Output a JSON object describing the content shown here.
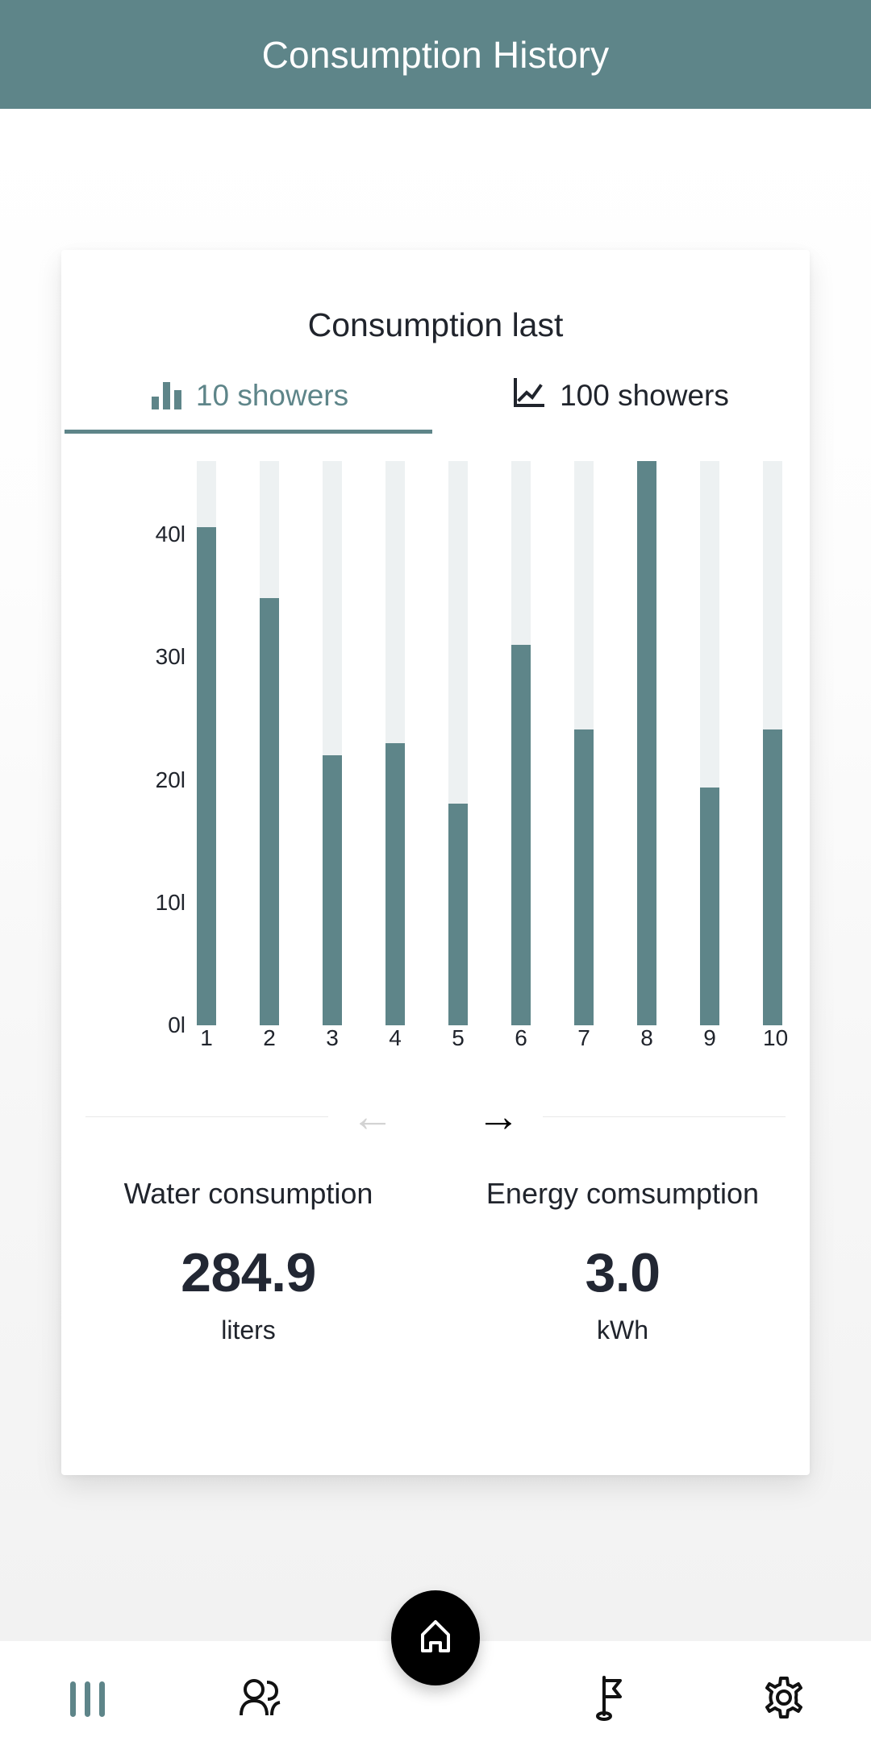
{
  "appbar": {
    "title": "Consumption History"
  },
  "card": {
    "title": "Consumption last",
    "tabs": [
      {
        "label": "10 showers",
        "icon": "bar-chart-icon",
        "active": true
      },
      {
        "label": "100 showers",
        "icon": "line-chart-icon",
        "active": false
      }
    ]
  },
  "pager": {
    "prev_icon": "arrow-left-icon",
    "prev_glyph": "←",
    "prev_enabled": false,
    "next_icon": "arrow-right-icon",
    "next_glyph": "→",
    "next_enabled": true
  },
  "stats": [
    {
      "label": "Water consumption",
      "value": "284.9",
      "unit": "liters"
    },
    {
      "label": "Energy comsumption",
      "value": "3.0",
      "unit": "kWh"
    }
  ],
  "bottom_nav": [
    {
      "name": "nav-item-stats",
      "icon": "sliders-icon",
      "active": true
    },
    {
      "name": "nav-item-users",
      "icon": "users-icon",
      "active": false
    },
    {
      "name": "nav-item-home",
      "icon": "home-icon",
      "active": true
    },
    {
      "name": "nav-item-goals",
      "icon": "flag-icon",
      "active": false
    },
    {
      "name": "nav-item-settings",
      "icon": "gear-icon",
      "active": false
    }
  ],
  "colors": {
    "accent": "#5e8589",
    "bar_fill": "#5e8589",
    "bar_track": "#edf1f2",
    "text": "#20242c",
    "fab": "#000000"
  },
  "chart_data": {
    "type": "bar",
    "title": "Consumption last 10 showers",
    "xlabel": "",
    "ylabel": "",
    "categories": [
      "1",
      "2",
      "3",
      "4",
      "5",
      "6",
      "7",
      "8",
      "9",
      "10"
    ],
    "values": [
      40.6,
      34.8,
      22.0,
      23.0,
      18.1,
      31.0,
      24.1,
      46.0,
      19.4,
      24.1
    ],
    "ytick_labels": [
      "40l",
      "30l",
      "20l",
      "10l",
      "0l"
    ],
    "ytick_values": [
      40,
      30,
      20,
      10,
      0
    ],
    "ylim": [
      0,
      46
    ],
    "track_max": 46,
    "unit": "l",
    "grid": false,
    "legend": "none"
  }
}
